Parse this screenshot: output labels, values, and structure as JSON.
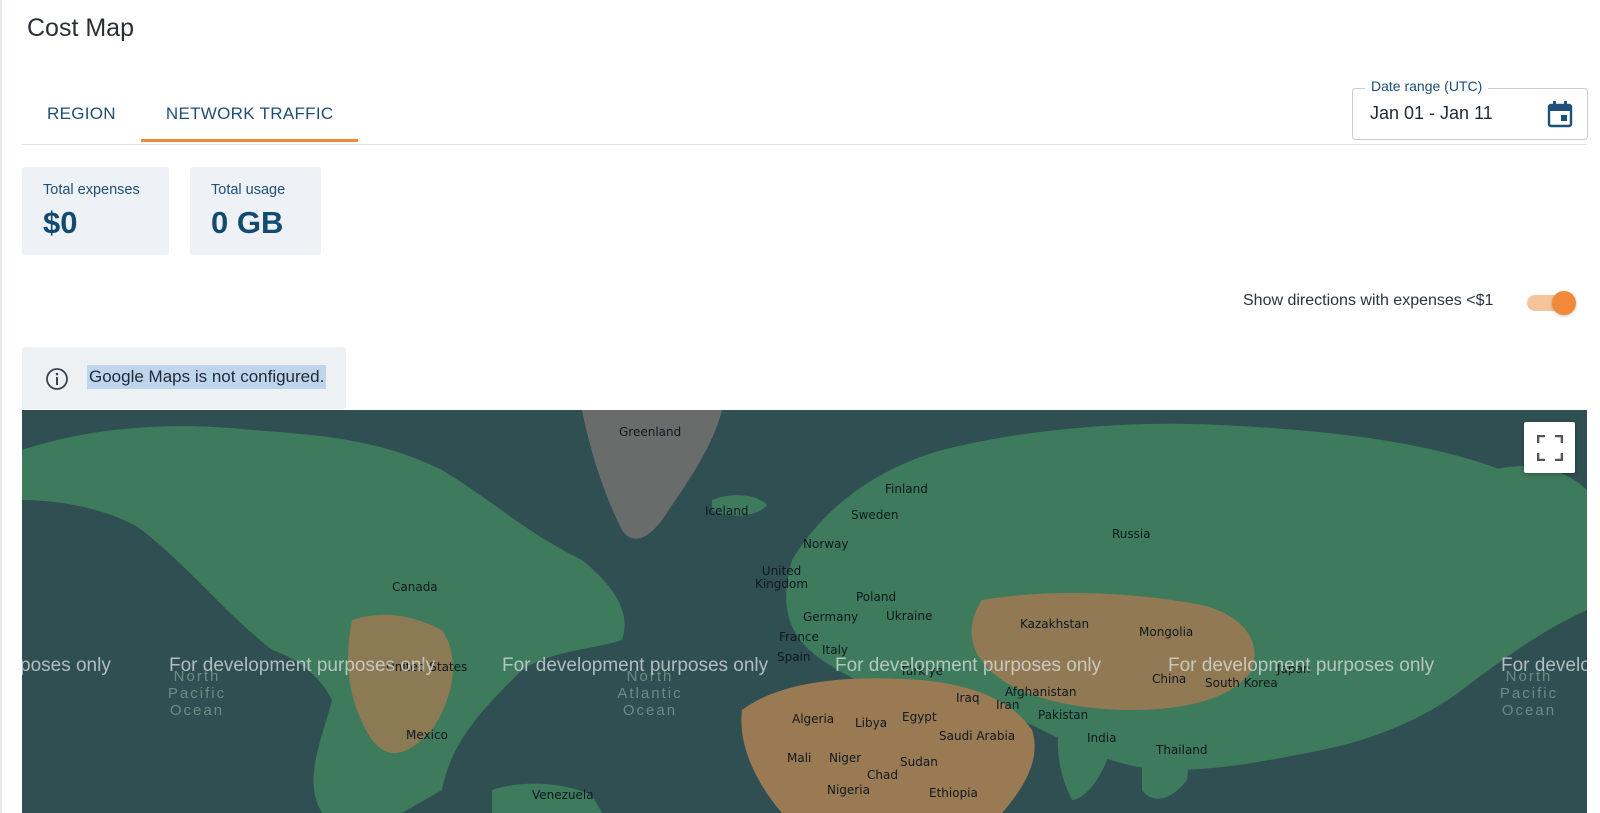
{
  "page": {
    "title": "Cost Map"
  },
  "tabs": [
    {
      "label": "REGION"
    },
    {
      "label": "NETWORK TRAFFIC"
    }
  ],
  "date_range": {
    "label": "Date range (UTC)",
    "value": "Jan 01 - Jan 11"
  },
  "summary": {
    "total_expenses": {
      "label": "Total expenses",
      "value": "$0"
    },
    "total_usage": {
      "label": "Total usage",
      "value": "0 GB"
    }
  },
  "toggle": {
    "label": "Show directions with expenses <$1",
    "checked": true
  },
  "alert": {
    "message": "Google Maps is not configured."
  },
  "map": {
    "watermark": "For development purposes only",
    "watermark_partial_left": "poses only",
    "watermark_partial_right": "For develo",
    "labels": {
      "greenland": "Greenland",
      "iceland": "Iceland",
      "finland": "Finland",
      "sweden": "Sweden",
      "norway": "Norway",
      "russia": "Russia",
      "united_kingdom": "United Kingdom",
      "poland": "Poland",
      "germany": "Germany",
      "ukraine": "Ukraine",
      "france": "France",
      "kazakhstan": "Kazakhstan",
      "mongolia": "Mongolia",
      "canada": "Canada",
      "united_states": "United States",
      "spain": "Spain",
      "italy": "Italy",
      "turkiye": "Türkiye",
      "japan": "Japan",
      "china": "China",
      "south_korea": "South Korea",
      "afghanistan": "Afghanistan",
      "iraq": "Iraq",
      "iran": "Iran",
      "pakistan": "Pakistan",
      "mexico": "Mexico",
      "algeria": "Algeria",
      "libya": "Libya",
      "egypt": "Egypt",
      "saudi_arabia": "Saudi Arabia",
      "india": "India",
      "thailand": "Thailand",
      "mali": "Mali",
      "niger": "Niger",
      "sudan": "Sudan",
      "chad": "Chad",
      "nigeria": "Nigeria",
      "ethiopia": "Ethiopia",
      "venezuela": "Venezuela"
    },
    "oceans": {
      "north_pacific_left": "North Pacific Ocean",
      "north_atlantic": "North Atlantic Ocean",
      "north_pacific_right": "North Pacific Ocean"
    }
  },
  "colors": {
    "accent": "#f08a38",
    "primary_text": "#1d4f78",
    "card_bg": "#eef2f6",
    "map_water": "#2f4f52",
    "map_land": "#3e7a5c",
    "map_desert": "#9a7a52"
  },
  "icons": {
    "date": "calendar-icon",
    "alert": "info-icon",
    "map_control": "fullscreen-icon"
  }
}
